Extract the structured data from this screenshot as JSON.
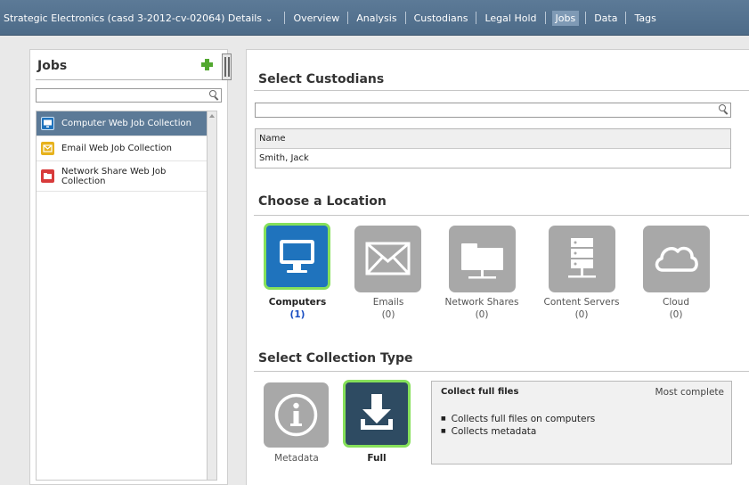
{
  "header": {
    "case_title": "Strategic Electronics (casd 3-2012-cv-02064) Details",
    "tabs": [
      {
        "label": "Overview"
      },
      {
        "label": "Analysis"
      },
      {
        "label": "Custodians"
      },
      {
        "label": "Legal Hold"
      },
      {
        "label": "Jobs"
      },
      {
        "label": "Data"
      },
      {
        "label": "Tags"
      }
    ],
    "active_tab": "Jobs"
  },
  "jobs_panel": {
    "title": "Jobs",
    "search_value": "",
    "items": [
      {
        "label": "Computer Web Job Collection",
        "icon": "monitor-icon",
        "color": "#1f73bd",
        "selected": true
      },
      {
        "label": "Email Web Job Collection",
        "icon": "envelope-icon",
        "color": "#e7b21c",
        "selected": false
      },
      {
        "label": "Network Share Web Job Collection",
        "icon": "folder-icon",
        "color": "#d83b3b",
        "selected": false
      }
    ]
  },
  "custodians": {
    "title": "Select Custodians",
    "search_value": "",
    "column_header": "Name",
    "rows": [
      "Smith, Jack"
    ]
  },
  "location": {
    "title": "Choose a Location",
    "options": [
      {
        "label": "Computers",
        "count": "(1)",
        "icon": "computer-icon",
        "selected": true
      },
      {
        "label": "Emails",
        "count": "(0)",
        "icon": "envelope-icon",
        "selected": false
      },
      {
        "label": "Network Shares",
        "count": "(0)",
        "icon": "folder-icon",
        "selected": false
      },
      {
        "label": "Content Servers",
        "count": "(0)",
        "icon": "server-icon",
        "selected": false
      },
      {
        "label": "Cloud",
        "count": "(0)",
        "icon": "cloud-icon",
        "selected": false
      }
    ]
  },
  "collection_type": {
    "title": "Select Collection Type",
    "options": [
      {
        "label": "Metadata",
        "icon": "info-icon",
        "selected": false
      },
      {
        "label": "Full",
        "icon": "download-icon",
        "selected": true
      }
    ],
    "details": {
      "title": "Collect full files",
      "meta": "Most complete",
      "bullets": [
        "Collects full files on computers",
        "Collects metadata"
      ]
    }
  },
  "colors": {
    "header_bar": "#5c7a97",
    "selected_blue": "#1f73bd",
    "selected_border": "#86e05a",
    "tile_gray": "#a8a8a8",
    "add_green": "#52a830"
  }
}
